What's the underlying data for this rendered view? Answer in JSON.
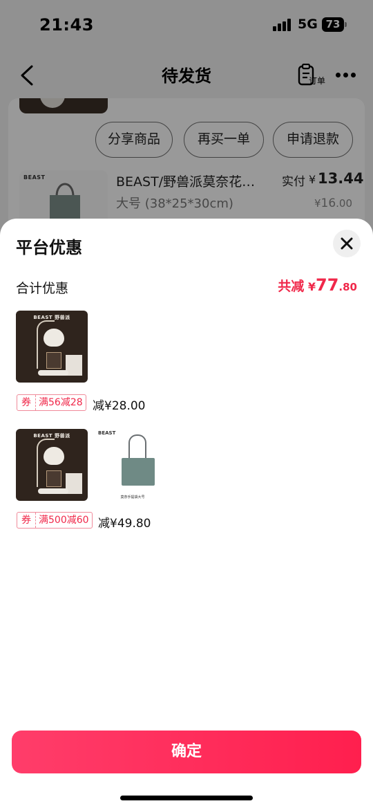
{
  "status_bar": {
    "time": "21:43",
    "network": "5G",
    "battery": "73"
  },
  "nav": {
    "title": "待发货",
    "order_label": "订单"
  },
  "background_order": {
    "actions": [
      "分享商品",
      "再买一单",
      "申请退款"
    ],
    "item": {
      "brand": "BEAST",
      "title": "BEAST/野兽派莫奈花…",
      "spec": "大号 (38*25*30cm)",
      "paid_label": "实付",
      "paid_yen": "¥",
      "paid_int": "13.44",
      "orig_yen": "¥",
      "orig_int": "16",
      "orig_dec": ".00"
    }
  },
  "sheet": {
    "title": "平台优惠",
    "total_label": "合计优惠",
    "total": {
      "prefix": "共减",
      "yen": "¥",
      "int": "77",
      "dec": ".80"
    },
    "groups": [
      {
        "coupon_type": "券",
        "coupon_rule": "满56减28",
        "discount": "减¥28.00",
        "image_brand": "BEAST 野兽派"
      },
      {
        "coupon_type": "券",
        "coupon_rule": "满500减60",
        "discount": "减¥49.80",
        "image_brand": "BEAST 野兽派",
        "bag_brand": "BEAST",
        "bag_caption": "莫奈手提袋大号"
      }
    ],
    "confirm_label": "确定"
  },
  "colors": {
    "accent": "#f0284a",
    "button": "#ff2d5b"
  }
}
